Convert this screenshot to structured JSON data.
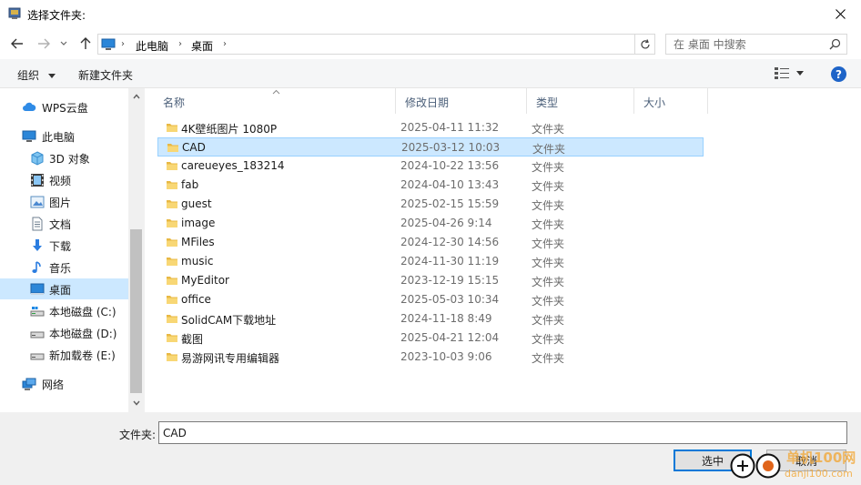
{
  "window": {
    "title": "选择文件夹:"
  },
  "address": {
    "crumbs": [
      "此电脑",
      "桌面"
    ],
    "search_placeholder": "在 桌面 中搜索"
  },
  "toolbar": {
    "organize_label": "组织",
    "new_folder_label": "新建文件夹",
    "help_label": "?"
  },
  "nav": {
    "items": [
      {
        "label": "WPS云盘",
        "icon": "cloud-icon"
      },
      {
        "label": "此电脑",
        "icon": "computer-icon"
      },
      {
        "label": "3D 对象",
        "icon": "3d-objects-icon"
      },
      {
        "label": "视频",
        "icon": "video-icon"
      },
      {
        "label": "图片",
        "icon": "pictures-icon"
      },
      {
        "label": "文档",
        "icon": "documents-icon"
      },
      {
        "label": "下载",
        "icon": "download-icon"
      },
      {
        "label": "音乐",
        "icon": "music-icon"
      },
      {
        "label": "桌面",
        "icon": "desktop-icon",
        "selected": true
      },
      {
        "label": "本地磁盘 (C:)",
        "icon": "drive-icon"
      },
      {
        "label": "本地磁盘 (D:)",
        "icon": "drive-icon"
      },
      {
        "label": "新加载卷 (E:)",
        "icon": "drive-icon"
      },
      {
        "label": "网络",
        "icon": "network-icon"
      }
    ]
  },
  "columns": {
    "name": "名称",
    "date": "修改日期",
    "type": "类型",
    "size": "大小"
  },
  "files": [
    {
      "name": "4K壁纸图片 1080P",
      "date": "2025-04-11 11:32",
      "type": "文件夹"
    },
    {
      "name": "CAD",
      "date": "2025-03-12 10:03",
      "type": "文件夹",
      "selected": true
    },
    {
      "name": "careueyes_183214",
      "date": "2024-10-22 13:56",
      "type": "文件夹"
    },
    {
      "name": "fab",
      "date": "2024-04-10 13:43",
      "type": "文件夹"
    },
    {
      "name": "guest",
      "date": "2025-02-15 15:59",
      "type": "文件夹"
    },
    {
      "name": "image",
      "date": "2025-04-26 9:14",
      "type": "文件夹"
    },
    {
      "name": "MFiles",
      "date": "2024-12-30 14:56",
      "type": "文件夹"
    },
    {
      "name": "music",
      "date": "2024-11-30 11:19",
      "type": "文件夹"
    },
    {
      "name": "MyEditor",
      "date": "2023-12-19 15:15",
      "type": "文件夹"
    },
    {
      "name": "office",
      "date": "2025-05-03 10:34",
      "type": "文件夹"
    },
    {
      "name": "SolidCAM下载地址",
      "date": "2024-11-18 8:49",
      "type": "文件夹"
    },
    {
      "name": "截图",
      "date": "2025-04-21 12:04",
      "type": "文件夹"
    },
    {
      "name": "易游网讯专用编辑器",
      "date": "2023-10-03 9:06",
      "type": "文件夹"
    }
  ],
  "footer": {
    "folder_label": "文件夹:",
    "folder_value": "CAD",
    "select_label": "选中",
    "cancel_label": "取消"
  },
  "watermark": {
    "line1": "单机100网",
    "line2": "danji100.com"
  },
  "colors": {
    "accent": "#0078d7",
    "selection": "#cce8ff",
    "folder": "#f8d775"
  }
}
